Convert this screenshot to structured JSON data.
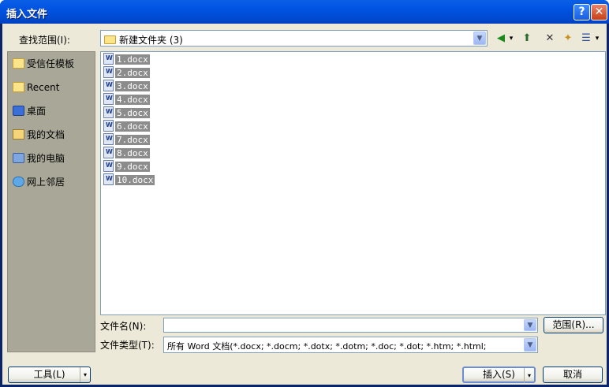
{
  "window": {
    "title": "插入文件",
    "help_glyph": "?",
    "close_glyph": "✕"
  },
  "lookin": {
    "label": "查找范围(I):",
    "value": "新建文件夹 (3)",
    "dropdown_glyph": "▼"
  },
  "toolbar": {
    "back_glyph": "◀",
    "back_arrow_glyph": "▾",
    "up_glyph": "⬆",
    "delete_glyph": "✕",
    "new_folder_glyph": "✦",
    "views_glyph": "☰",
    "views_arrow_glyph": "▾"
  },
  "places": [
    {
      "label": "受信任模板",
      "icon": "folder-icon"
    },
    {
      "label": "Recent",
      "icon": "folder-icon"
    },
    {
      "label": "桌面",
      "icon": "desktop-icon"
    },
    {
      "label": "我的文档",
      "icon": "documents-icon"
    },
    {
      "label": "我的电脑",
      "icon": "computer-icon"
    },
    {
      "label": "网上邻居",
      "icon": "network-icon"
    }
  ],
  "files": [
    {
      "name": "1.docx"
    },
    {
      "name": "2.docx"
    },
    {
      "name": "3.docx"
    },
    {
      "name": "4.docx"
    },
    {
      "name": "5.docx"
    },
    {
      "name": "6.docx"
    },
    {
      "name": "7.docx"
    },
    {
      "name": "8.docx"
    },
    {
      "name": "9.docx"
    },
    {
      "name": "10.docx"
    }
  ],
  "filename": {
    "label": "文件名(N):",
    "value": "",
    "dropdown_glyph": "▼"
  },
  "range_button": "范围(R)...",
  "filetype": {
    "label": "文件类型(T):",
    "value": "所有 Word 文档(*.docx; *.docm; *.dotx; *.dotm; *.doc; *.dot; *.htm; *.html;",
    "dropdown_glyph": "▼"
  },
  "tools_button": {
    "label": "工具(L)",
    "dropdown_glyph": "▾"
  },
  "insert_button": {
    "label": "插入(S)",
    "dropdown_glyph": "▾"
  },
  "cancel_button": "取消",
  "colors": {
    "titlebar": "#0053e1",
    "dialog_bg": "#ece9d8",
    "places_bg": "#a9a798",
    "selection_bg": "#8c8c8c"
  }
}
